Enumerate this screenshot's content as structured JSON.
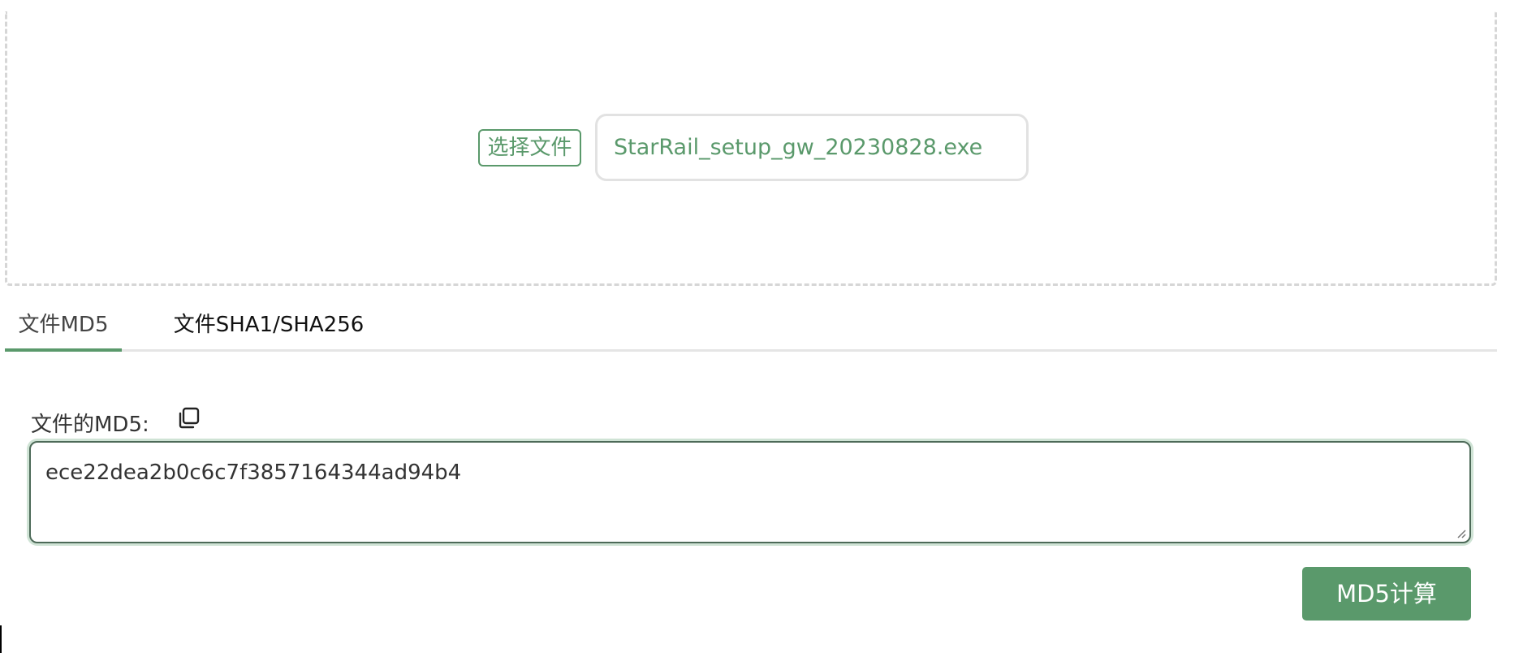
{
  "upload": {
    "choose_label": "选择文件",
    "file_name": "StarRail_setup_gw_20230828.exe"
  },
  "tabs": [
    {
      "label": "文件MD5",
      "active": true
    },
    {
      "label": "文件SHA1/SHA256",
      "active": false
    }
  ],
  "result": {
    "label": "文件的MD5:",
    "value": "ece22dea2b0c6c7f3857164344ad94b4",
    "copy_icon": "copy-icon"
  },
  "actions": {
    "calc_label": "MD5计算"
  },
  "colors": {
    "accent": "#5a996b",
    "border": "#e2e2e2",
    "text": "#333333"
  }
}
